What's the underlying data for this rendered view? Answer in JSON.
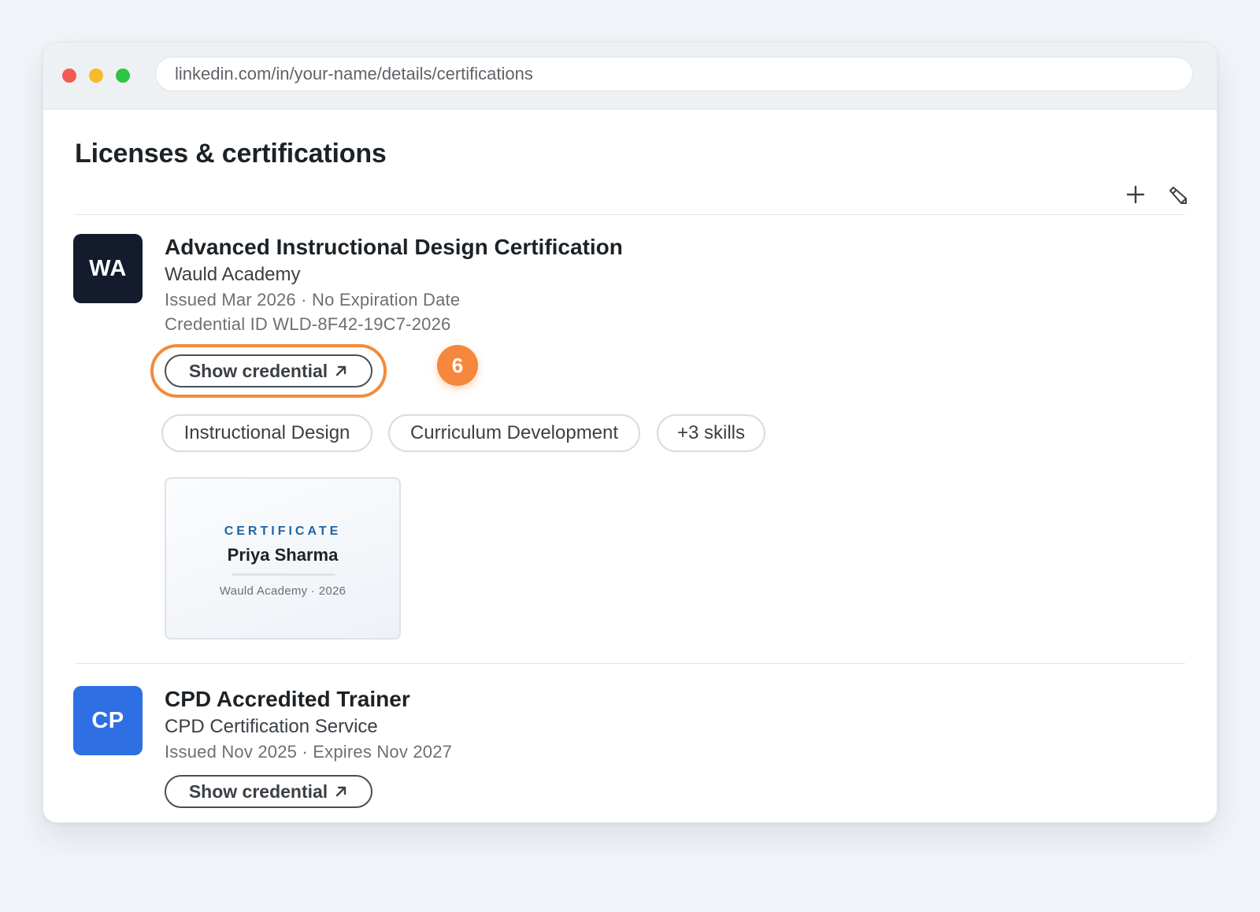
{
  "browser": {
    "url": "linkedin.com/in/your-name/details/certifications"
  },
  "section": {
    "title": "Licenses & certifications",
    "icons": {
      "add": "plus-icon",
      "edit": "pencil-icon"
    }
  },
  "certifications": [
    {
      "logo_text": "WA",
      "logo_color": "#141b2d",
      "title": "Advanced Instructional Design Certification",
      "issuer": "Wauld Academy",
      "dates": "Issued Mar 2026 · No Expiration Date",
      "credential_id": "Credential ID WLD-8F42-19C7-2026",
      "button_label": "Show credential",
      "button_icon": "external-link-arrow-icon",
      "skills": [
        "Instructional Design",
        "Curriculum Development",
        "+3 skills"
      ],
      "thumbnail": {
        "label": "CERTIFICATE",
        "name": "Priya Sharma",
        "subtitle": "Wauld Academy · 2026"
      }
    },
    {
      "logo_text": "CP",
      "logo_color": "#2f6fe4",
      "title": "CPD Accredited Trainer",
      "issuer": "CPD Certification Service",
      "dates": "Issued Nov 2025 · Expires Nov 2027",
      "button_label": "Show credential",
      "button_icon": "external-link-arrow-icon"
    }
  ],
  "annotation": {
    "step_number": "6",
    "highlight_color": "#f28b3a"
  }
}
